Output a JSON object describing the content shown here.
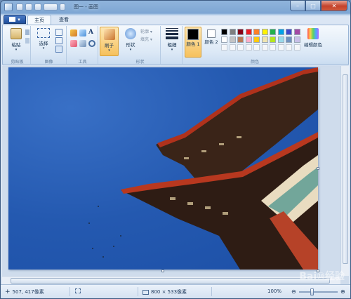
{
  "window": {
    "title": "图一 - 画图",
    "caption_buttons": {
      "minimize": "–",
      "maximize": "□",
      "close": "✕"
    }
  },
  "menu_button": {
    "label": "▾"
  },
  "tabs": [
    {
      "label": "主页",
      "active": true
    },
    {
      "label": "查看",
      "active": false
    }
  ],
  "ribbon": {
    "groups": {
      "clipboard": {
        "label": "剪贴板",
        "paste": "粘贴"
      },
      "image": {
        "label": "图像",
        "select": "选择"
      },
      "tools": {
        "label": "工具"
      },
      "brushes": {
        "label": "刷子"
      },
      "shapes": {
        "label": "形状",
        "shapes_btn": "形状",
        "outline": "轮廓 ▾",
        "fill": "填充 ▾"
      },
      "size": {
        "label": "粗细"
      },
      "colors": {
        "label": "颜色",
        "color1": "颜色 1",
        "color2": "颜色 2",
        "edit_colors": "编辑颜色",
        "palette_row1": [
          "#000000",
          "#7f7f7f",
          "#880015",
          "#ed1c24",
          "#ff7f27",
          "#fff200",
          "#22b14c",
          "#00a2e8",
          "#3f48cc",
          "#a349a4"
        ],
        "palette_row2": [
          "#ffffff",
          "#c3c3c3",
          "#b97a57",
          "#ffaec9",
          "#ffc90e",
          "#efe4b0",
          "#b5e61d",
          "#99d9ea",
          "#7092be",
          "#c8bfe7"
        ]
      }
    }
  },
  "status": {
    "cursor_pos": "507, 417像素",
    "image_size": "800 × 533像素",
    "zoom": "100%"
  },
  "watermark": "Bai⑩经验"
}
